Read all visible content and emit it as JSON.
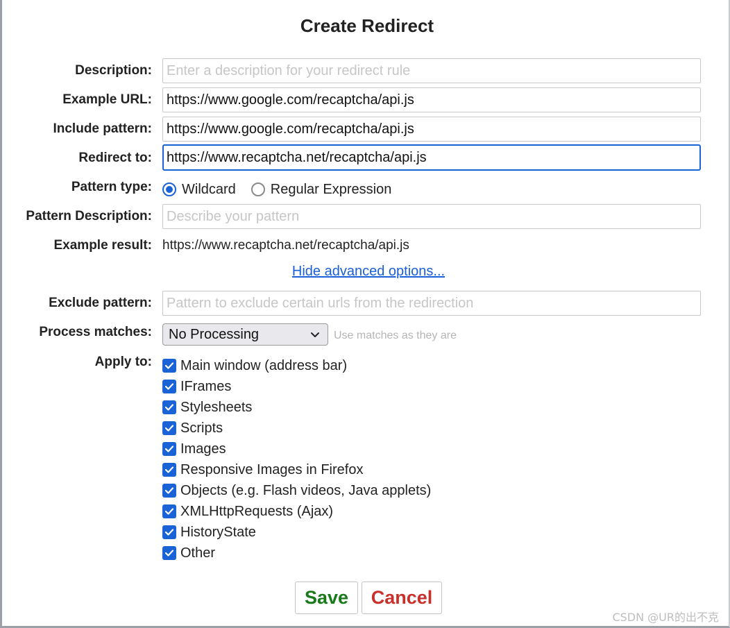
{
  "dialog": {
    "title": "Create Redirect"
  },
  "form": {
    "description": {
      "label": "Description:",
      "value": "",
      "placeholder": "Enter a description for your redirect rule"
    },
    "example_url": {
      "label": "Example URL:",
      "value": "https://www.google.com/recaptcha/api.js",
      "placeholder": ""
    },
    "include_pattern": {
      "label": "Include pattern:",
      "value": "https://www.google.com/recaptcha/api.js",
      "placeholder": ""
    },
    "redirect_to": {
      "label": "Redirect to:",
      "value": "https://www.recaptcha.net/recaptcha/api.js",
      "placeholder": ""
    },
    "pattern_type": {
      "label": "Pattern type:",
      "options": [
        {
          "label": "Wildcard",
          "checked": true
        },
        {
          "label": "Regular Expression",
          "checked": false
        }
      ]
    },
    "pattern_description": {
      "label": "Pattern Description:",
      "value": "",
      "placeholder": "Describe your pattern"
    },
    "example_result": {
      "label": "Example result:",
      "value": "https://www.recaptcha.net/recaptcha/api.js"
    },
    "advanced_toggle": "Hide advanced options...",
    "exclude_pattern": {
      "label": "Exclude pattern:",
      "value": "",
      "placeholder": "Pattern to exclude certain urls from the redirection"
    },
    "process_matches": {
      "label": "Process matches:",
      "selected": "No Processing",
      "hint": "Use matches as they are"
    },
    "apply_to": {
      "label": "Apply to:",
      "items": [
        {
          "label": "Main window (address bar)",
          "checked": true
        },
        {
          "label": "IFrames",
          "checked": true
        },
        {
          "label": "Stylesheets",
          "checked": true
        },
        {
          "label": "Scripts",
          "checked": true
        },
        {
          "label": "Images",
          "checked": true
        },
        {
          "label": "Responsive Images in Firefox",
          "checked": true
        },
        {
          "label": "Objects (e.g. Flash videos, Java applets)",
          "checked": true
        },
        {
          "label": "XMLHttpRequests (Ajax)",
          "checked": true
        },
        {
          "label": "HistoryState",
          "checked": true
        },
        {
          "label": "Other",
          "checked": true
        }
      ]
    }
  },
  "buttons": {
    "save": "Save",
    "cancel": "Cancel"
  },
  "watermark": "CSDN @UR的出不克",
  "colors": {
    "accent": "#1a63d6",
    "save": "#1a7a1a",
    "cancel": "#c9302c",
    "link": "#1a5fd8"
  }
}
